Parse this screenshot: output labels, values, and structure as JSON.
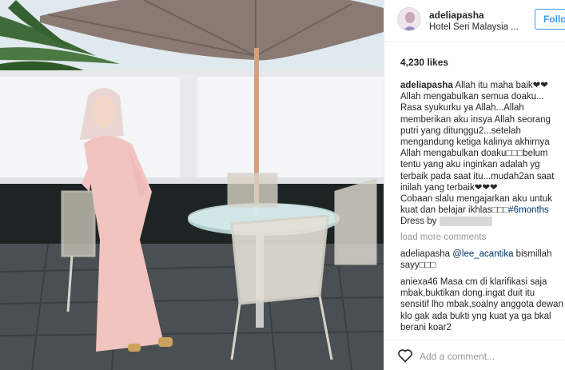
{
  "post": {
    "username": "adeliapasha",
    "location": "Hotel Seri Malaysia ...",
    "follow_label": "Follo",
    "likes": "4,230 likes"
  },
  "caption": {
    "username": "adeliapasha",
    "lines": [
      "Allah itu maha baik❤❤",
      "Allah mengabulkan semua doaku...",
      "Rasa syukurku ya Allah...Allah",
      "memberikan aku insya Allah seorang",
      "putri yang ditunggu2...setelah",
      "mengandung ketiga kalinya akhirnya",
      "Allah mengabulkan doaku□□□belum",
      "tentu yang aku inginkan adalah yg",
      "terbaik pada saat itu...mudah2an saat",
      "inilah yang terbaik❤❤❤",
      "Cobaan slalu mengajarkan aku untuk",
      "kuat dan belajar ikhlas□□□"
    ],
    "hashtag": "#6months",
    "dress_label": "Dress by"
  },
  "load_more": "load more comments",
  "comments": [
    {
      "username": "adeliapasha",
      "mention": "@lee_acantika",
      "text_after_mention": " bismillah",
      "line2": "sayy□□□"
    },
    {
      "username": "aniexa46",
      "lines": [
        "Masa cm di klarifikasi saja",
        "mbak,buktikan dong.ingat duit itu",
        "sensitif lho mbak,soalny anggota dewan",
        "klo gak ada bukti yng kuat ya ga bkal",
        "berani koar2"
      ]
    }
  ],
  "add_comment_placeholder": "Add a comment...",
  "icons": {
    "like": "heart-outline-icon",
    "avatar": "profile-avatar"
  },
  "colors": {
    "follow_blue": "#3897f0",
    "link_blue": "#003569",
    "muted": "#999999"
  }
}
